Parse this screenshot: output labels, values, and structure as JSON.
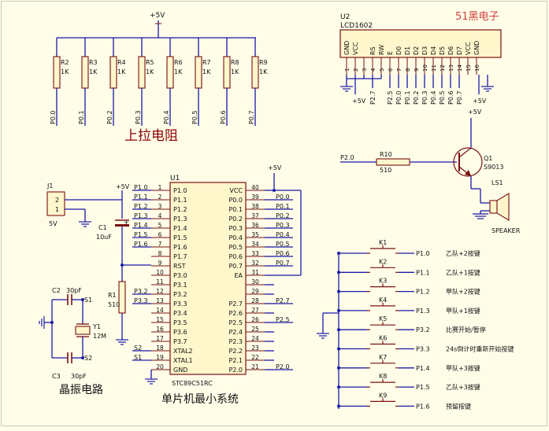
{
  "colors": {
    "wire": "#1a1aa8",
    "component": "#7a1010",
    "text": "#111111",
    "cjk": "#8b0000",
    "fill": "#fff6cc"
  },
  "supply": {
    "vcc_top": "+5V",
    "vcc_j1": "+5V",
    "vcc_u1": "+5V",
    "vcc_lcd": "+5V",
    "vcc_q1": "+5V"
  },
  "pullups": {
    "resistors": [
      {
        "ref": "R2",
        "value": "1K",
        "net": "P0.0"
      },
      {
        "ref": "R3",
        "value": "1K",
        "net": "P0.1"
      },
      {
        "ref": "R4",
        "value": "1K",
        "net": "P0.2"
      },
      {
        "ref": "R5",
        "value": "1K",
        "net": "P0.3"
      },
      {
        "ref": "R6",
        "value": "1K",
        "net": "P0.4"
      },
      {
        "ref": "R7",
        "value": "1K",
        "net": "P0.5"
      },
      {
        "ref": "R8",
        "value": "1K",
        "net": "P0.6"
      },
      {
        "ref": "R9",
        "value": "1K",
        "net": "P0.7"
      }
    ],
    "caption": "上拉电阻"
  },
  "lcd": {
    "ref": "U2",
    "part": "LCD1602",
    "brand": "51黑电子",
    "pins": [
      {
        "num": "1",
        "name": "GND",
        "net": ""
      },
      {
        "num": "2",
        "name": "VCC",
        "net": ""
      },
      {
        "num": "3",
        "name": "",
        "net": ""
      },
      {
        "num": "4",
        "name": "RS",
        "net": "P2.7"
      },
      {
        "num": "5",
        "name": "RW",
        "net": ""
      },
      {
        "num": "6",
        "name": "E",
        "net": "P2.5"
      },
      {
        "num": "7",
        "name": "D0",
        "net": "P0.0"
      },
      {
        "num": "8",
        "name": "D1",
        "net": "P0.1"
      },
      {
        "num": "9",
        "name": "D2",
        "net": "P0.2"
      },
      {
        "num": "10",
        "name": "D3",
        "net": "P0.3"
      },
      {
        "num": "11",
        "name": "D4",
        "net": "P0.4"
      },
      {
        "num": "12",
        "name": "D5",
        "net": "P0.5"
      },
      {
        "num": "13",
        "name": "D6",
        "net": "P0.6"
      },
      {
        "num": "14",
        "name": "D7",
        "net": "P0.7"
      },
      {
        "num": "15",
        "name": "VCC",
        "net": ""
      },
      {
        "num": "16",
        "name": "GND",
        "net": ""
      }
    ]
  },
  "buzzer": {
    "net": "P2.0",
    "r_ref": "R10",
    "r_value": "510",
    "q_ref": "Q1",
    "q_part": "S9013",
    "ls_ref": "LS1",
    "ls_name": "SPEAKER"
  },
  "connector": {
    "ref": "J1",
    "pin1": "1",
    "pin2": "2",
    "label": "5V"
  },
  "reset": {
    "c_ref": "C1",
    "c_value": "10uF",
    "plus": "+",
    "r_ref": "R1",
    "r_value": "510"
  },
  "mcu": {
    "ref": "U1",
    "part": "STC89C51RC",
    "caption": "单片机最小系统",
    "left_pins": [
      {
        "num": "1",
        "name": "P1.0",
        "net": "P1.0"
      },
      {
        "num": "2",
        "name": "P1.1",
        "net": "P1.1"
      },
      {
        "num": "3",
        "name": "P1.2",
        "net": "P1.2"
      },
      {
        "num": "4",
        "name": "P1.3",
        "net": "P1.3"
      },
      {
        "num": "5",
        "name": "P1.4",
        "net": "P1.4"
      },
      {
        "num": "6",
        "name": "P1.5",
        "net": "P1.5"
      },
      {
        "num": "7",
        "name": "P1.6",
        "net": "P1.6"
      },
      {
        "num": "8",
        "name": "P1.7",
        "net": ""
      },
      {
        "num": "9",
        "name": "RST",
        "net": ""
      },
      {
        "num": "10",
        "name": "P3.0",
        "net": ""
      },
      {
        "num": "11",
        "name": "P3.1",
        "net": ""
      },
      {
        "num": "12",
        "name": "P3.2",
        "net": "P3.2"
      },
      {
        "num": "13",
        "name": "P3.3",
        "net": "P3.3"
      },
      {
        "num": "14",
        "name": "P3.4",
        "net": ""
      },
      {
        "num": "15",
        "name": "P3.5",
        "net": ""
      },
      {
        "num": "16",
        "name": "P3.6",
        "net": ""
      },
      {
        "num": "17",
        "name": "P3.7",
        "net": ""
      },
      {
        "num": "18",
        "name": "XTAL2",
        "net": "S2"
      },
      {
        "num": "19",
        "name": "XTAL1",
        "net": "S1"
      },
      {
        "num": "20",
        "name": "GND",
        "net": ""
      }
    ],
    "right_pins": [
      {
        "num": "40",
        "name": "VCC",
        "net": ""
      },
      {
        "num": "39",
        "name": "P0.0",
        "net": "P0.0"
      },
      {
        "num": "38",
        "name": "P0.1",
        "net": "P0.1"
      },
      {
        "num": "37",
        "name": "P0.2",
        "net": "P0.2"
      },
      {
        "num": "36",
        "name": "P0.3",
        "net": "P0.3"
      },
      {
        "num": "35",
        "name": "P0.4",
        "net": "P0.4"
      },
      {
        "num": "34",
        "name": "P0.5",
        "net": "P0.5"
      },
      {
        "num": "33",
        "name": "P0.6",
        "net": "P0.6"
      },
      {
        "num": "32",
        "name": "P0.7",
        "net": "P0.7"
      },
      {
        "num": "31",
        "name": "EA",
        "net": ""
      },
      {
        "num": "30",
        "name": "",
        "net": ""
      },
      {
        "num": "29",
        "name": "",
        "net": ""
      },
      {
        "num": "28",
        "name": "P2.7",
        "net": "P2.7"
      },
      {
        "num": "27",
        "name": "P2.6",
        "net": ""
      },
      {
        "num": "26",
        "name": "P2.5",
        "net": "P2.5"
      },
      {
        "num": "25",
        "name": "P2.4",
        "net": ""
      },
      {
        "num": "24",
        "name": "P2.3",
        "net": ""
      },
      {
        "num": "23",
        "name": "P2.2",
        "net": ""
      },
      {
        "num": "22",
        "name": "P2.1",
        "net": ""
      },
      {
        "num": "21",
        "name": "P2.0",
        "net": "P2.0"
      }
    ]
  },
  "oscillator": {
    "c2_ref": "C2",
    "c2_value": "30pF",
    "c3_ref": "C3",
    "c3_value": "30pF",
    "y_ref": "Y1",
    "y_value": "12M",
    "s1": "S1",
    "s2": "S2",
    "caption": "晶振电路"
  },
  "keys": [
    {
      "ref": "K1",
      "net": "P1.0",
      "desc": "乙队+2按键"
    },
    {
      "ref": "K2",
      "net": "P1.1",
      "desc": "乙队+1按键"
    },
    {
      "ref": "K3",
      "net": "P1.2",
      "desc": "甲队+2按键"
    },
    {
      "ref": "K4",
      "net": "P1.3",
      "desc": "甲队+1按键"
    },
    {
      "ref": "K5",
      "net": "P3.2",
      "desc": "比赛开始/暂停"
    },
    {
      "ref": "K6",
      "net": "P3.3",
      "desc": "24s倒计时重新开始按键"
    },
    {
      "ref": "K7",
      "net": "P1.4",
      "desc": "甲队+3按键"
    },
    {
      "ref": "K8",
      "net": "P1.5",
      "desc": "乙队+3按键"
    },
    {
      "ref": "K9",
      "net": "P1.6",
      "desc": "预留按键"
    }
  ]
}
